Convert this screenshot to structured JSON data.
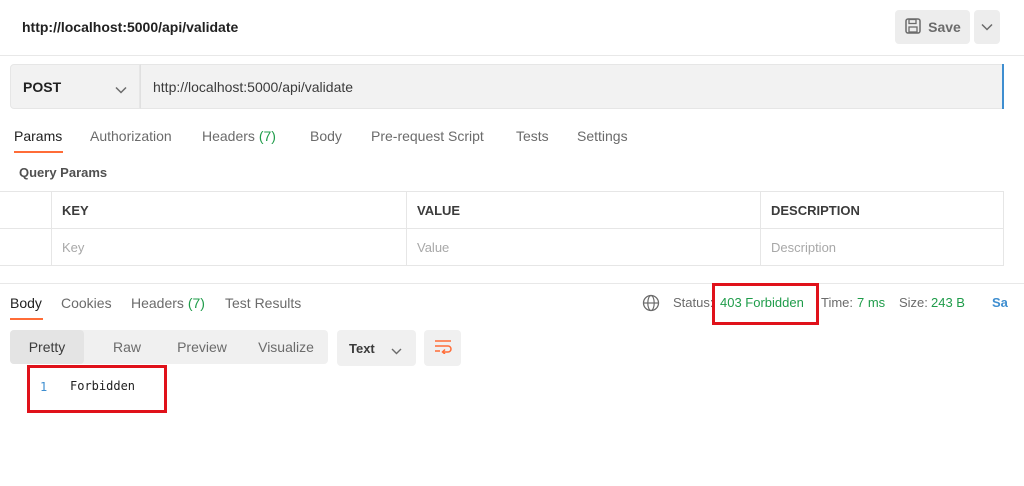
{
  "request": {
    "title": "http://localhost:5000/api/validate",
    "save_label": "Save",
    "method": "POST",
    "url": "http://localhost:5000/api/validate"
  },
  "request_tabs": [
    {
      "label": "Params",
      "count": ""
    },
    {
      "label": "Authorization",
      "count": ""
    },
    {
      "label": "Headers",
      "count": "(7)"
    },
    {
      "label": "Body",
      "count": ""
    },
    {
      "label": "Pre-request Script",
      "count": ""
    },
    {
      "label": "Tests",
      "count": ""
    },
    {
      "label": "Settings",
      "count": ""
    }
  ],
  "query_params": {
    "heading": "Query Params",
    "columns": [
      "KEY",
      "VALUE",
      "DESCRIPTION"
    ],
    "placeholders": [
      "Key",
      "Value",
      "Description"
    ]
  },
  "response_tabs": [
    {
      "label": "Body",
      "count": ""
    },
    {
      "label": "Cookies",
      "count": ""
    },
    {
      "label": "Headers",
      "count": "(7)"
    },
    {
      "label": "Test Results",
      "count": ""
    }
  ],
  "response_meta": {
    "status_label": "Status:",
    "status_value": "403 Forbidden",
    "time_label": "Time:",
    "time_value": "7 ms",
    "size_label": "Size:",
    "size_value": "243 B",
    "truncated_link": "Sa"
  },
  "view_modes": [
    "Pretty",
    "Raw",
    "Preview",
    "Visualize"
  ],
  "format": "Text",
  "response_body": {
    "line_number": "1",
    "text": "Forbidden"
  },
  "icons": [
    "save-icon",
    "chevron-down-icon",
    "globe-icon",
    "wrap-lines-icon"
  ],
  "colors": {
    "accent": "#ff6c37",
    "success": "#1f9c4a",
    "link": "#3e8ed0",
    "annotation": "#e0111a"
  }
}
